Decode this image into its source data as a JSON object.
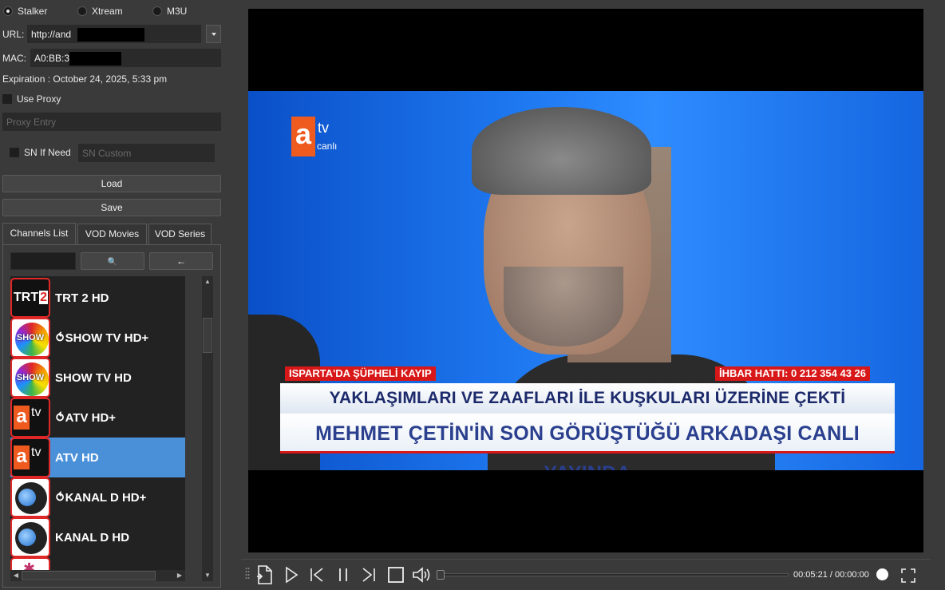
{
  "mode_options": [
    {
      "label": "Stalker",
      "selected": true
    },
    {
      "label": "Xtream",
      "selected": false
    },
    {
      "label": "M3U",
      "selected": false
    }
  ],
  "url": {
    "label": "URL:",
    "value": "http://and"
  },
  "mac": {
    "label": "MAC:",
    "value": "A0:BB:3l"
  },
  "expiration": "Expiration : October 24, 2025, 5:33 pm",
  "proxy": {
    "checkbox_label": "Use Proxy",
    "placeholder": "Proxy Entry"
  },
  "sn": {
    "checkbox_label": "SN If Need",
    "placeholder": "SN Custom"
  },
  "buttons": {
    "load": "Load",
    "save": "Save"
  },
  "tabs": [
    {
      "label": "Channels List",
      "active": true
    },
    {
      "label": "VOD Movies",
      "active": false
    },
    {
      "label": "VOD Series",
      "active": false
    }
  ],
  "channel_toolbar": {
    "search_icon": "🔍",
    "back_icon": "←"
  },
  "channels": [
    {
      "name": "TRT 2 HD",
      "logo": "trt2-logo",
      "selected": false
    },
    {
      "name": "⥀SHOW TV HD+",
      "logo": "show-logo",
      "selected": false
    },
    {
      "name": "SHOW TV HD",
      "logo": "show-logo",
      "selected": false
    },
    {
      "name": "⥀ATV HD+",
      "logo": "atv-logo",
      "selected": false
    },
    {
      "name": "ATV HD",
      "logo": "atv-logo",
      "selected": true
    },
    {
      "name": "⥀KANAL D HD+",
      "logo": "kanald-logo",
      "selected": false
    },
    {
      "name": "KANAL D HD",
      "logo": "kanald-logo",
      "selected": false
    },
    {
      "name": "",
      "logo": "star-logo",
      "selected": false
    }
  ],
  "video": {
    "channel_bug": {
      "brand": "a",
      "tv": "tv",
      "live": "canlı"
    },
    "ticker_left": "ISPARTA'DA ŞÜPHELİ KAYIP",
    "ticker_right": "İHBAR HATTI: 0 212 354 43 26",
    "headline_top": "YAKLAŞIMLARI VE ZAAFLARI İLE KUŞKULARI ÜZERİNE ÇEKTİ",
    "headline_bottom": "MEHMET ÇETİN'İN SON GÖRÜŞTÜĞÜ ARKADAŞI CANLI YAYINDA"
  },
  "player": {
    "time": "00:05:21 / 00:00:00",
    "progress": 0.0
  }
}
